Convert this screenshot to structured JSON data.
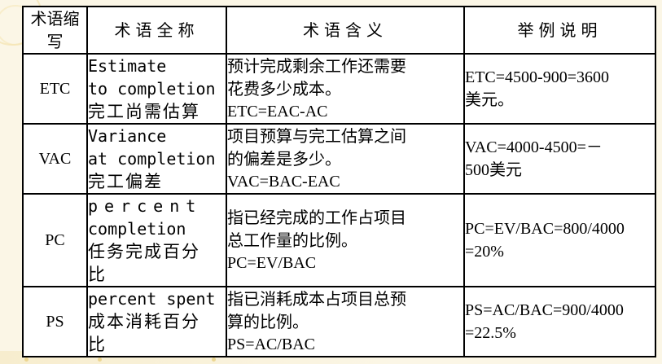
{
  "table": {
    "headers": {
      "abbr": "术语缩写",
      "full_name": "术语全称",
      "meaning": "术语含义",
      "example": "举例说明"
    },
    "rows": [
      {
        "abbr": "ETC",
        "name_lines": [
          "Estimate",
          "to completion",
          "完工尚需估算"
        ],
        "meaning_lines": [
          "预计完成剩余工作还需要",
          "花费多少成本。",
          "ETC=EAC-AC"
        ],
        "example_lines": [
          "ETC=4500-900=3600",
          "美元。"
        ]
      },
      {
        "abbr": "VAC",
        "name_lines": [
          "Variance",
          "at completion",
          "完工偏差"
        ],
        "meaning_lines": [
          "项目预算与完工估算之间",
          "的偏差是多少。",
          "VAC=BAC-EAC"
        ],
        "example_lines": [
          "VAC=4000-4500=－",
          "500美元"
        ]
      },
      {
        "abbr": "PC",
        "name_lines": [
          "percent",
          "completion",
          "任务完成百分",
          "比"
        ],
        "meaning_lines": [
          "指已经完成的工作占项目",
          "总工作量的比例。",
          "PC=EV/BAC"
        ],
        "example_lines": [
          "PC=EV/BAC=800/4000",
          "=20%"
        ]
      },
      {
        "abbr": "PS",
        "name_lines": [
          "percent spent",
          "成本消耗百分",
          "比"
        ],
        "meaning_lines": [
          "指已消耗成本占项目总预",
          "算的比例。",
          "PS=AC/BAC"
        ],
        "example_lines": [
          "PS=AC/BAC=900/4000",
          "=22.5%"
        ]
      }
    ]
  },
  "colors": {
    "background": "#fbf6e6",
    "table_bg": "#ffffff",
    "border": "#000000",
    "accent_circle": "#f3dfa0"
  }
}
